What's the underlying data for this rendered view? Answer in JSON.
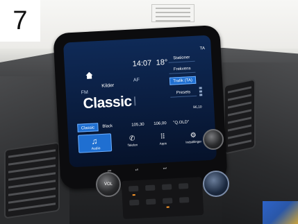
{
  "badge": {
    "number": "7"
  },
  "status_bar": {
    "time": "14:07",
    "temperature": "18°",
    "ta": "TA"
  },
  "source": {
    "kilder": "Kilder",
    "af": "AF",
    "band": "FM"
  },
  "station": {
    "name": "Classic",
    "ghost": "I"
  },
  "right_menu": [
    {
      "label": "Stationer",
      "active": false
    },
    {
      "label": "Frekvens",
      "active": false
    },
    {
      "label": "Trafik (TA)",
      "active": true
    },
    {
      "label": "Presets",
      "active": false
    }
  ],
  "presets": [
    {
      "label": "Classic",
      "active": true
    },
    {
      "label": "Black",
      "active": false
    },
    {
      "label": "105,30",
      "active": false
    },
    {
      "label": "106,00",
      "active": false
    },
    {
      "label": "\"Q.OLD\"",
      "active": false
    }
  ],
  "preset_extra": "96,10",
  "dock": {
    "audio": {
      "label": "Audio"
    },
    "telefon": {
      "label": "Telefon"
    },
    "apps": {
      "label": "Apps"
    },
    "indstillinger": {
      "label": "Indstillinger"
    }
  },
  "controls": {
    "vol": "VOL",
    "prev": "⏮",
    "play": "⏯",
    "next": "⏭"
  },
  "icons": [
    "home-icon",
    "music-note-icon",
    "phone-icon",
    "apps-grid-icon",
    "settings-gear-icon"
  ],
  "colors": {
    "screen_bg": "#0f2a57",
    "accent": "#1f6fd1",
    "text": "#ffffff"
  }
}
